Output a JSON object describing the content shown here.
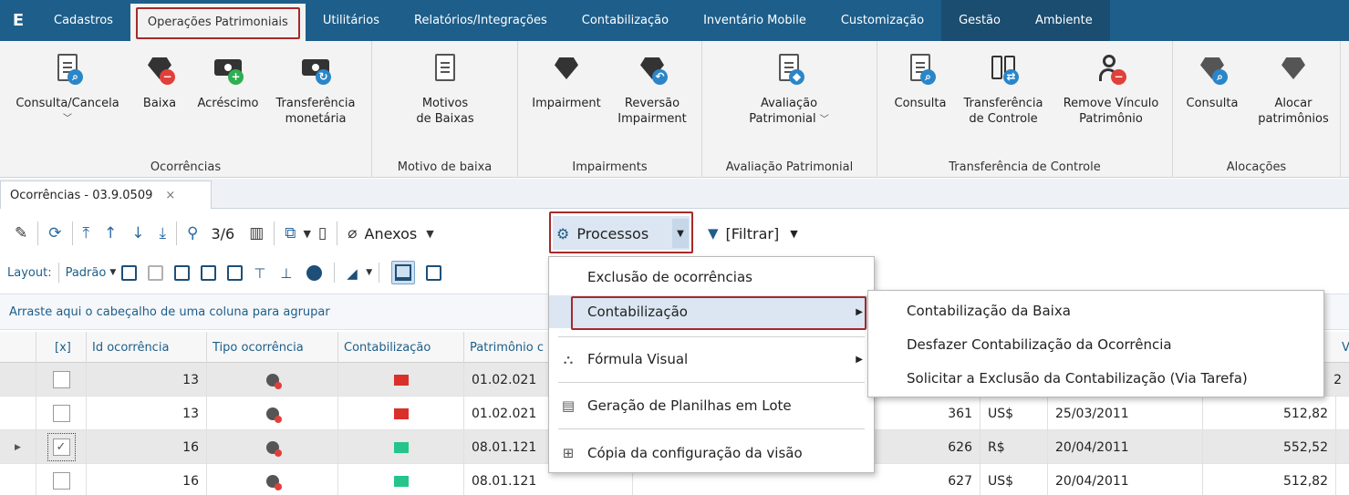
{
  "menubar": {
    "logo": "E",
    "items": [
      "Cadastros",
      "Operações Patrimoniais",
      "Utilitários",
      "Relatórios/Integrações",
      "Contabilização",
      "Inventário Mobile",
      "Customização",
      "Gestão",
      "Ambiente"
    ]
  },
  "ribbon": {
    "groups": [
      {
        "label": "Ocorrências",
        "buttons": [
          "Consulta/Cancela",
          "Baixa",
          "Acréscimo",
          "Transferência",
          "monetária"
        ]
      },
      {
        "label": "Motivo de baixa",
        "buttons": [
          "Motivos",
          "de Baixas"
        ]
      },
      {
        "label": "Impairments",
        "buttons": [
          "Impairment",
          "Reversão",
          "Impairment"
        ]
      },
      {
        "label": "Avaliação Patrimonial",
        "buttons": [
          "Avaliação",
          "Patrimonial"
        ]
      },
      {
        "label": "Transferência de Controle",
        "buttons": [
          "Consulta",
          "Transferência",
          "de Controle",
          "Remove Vínculo",
          "Patrimônio"
        ]
      },
      {
        "label": "Alocações",
        "buttons": [
          "Consulta",
          "Alocar",
          "patrimônios"
        ]
      }
    ]
  },
  "doctab": {
    "title": "Ocorrências - 03.9.0509",
    "close": "×"
  },
  "toolbar": {
    "counter": "3/6",
    "anexos": "Anexos",
    "processos": "Processos",
    "filtrar": "[Filtrar]"
  },
  "toolbar2": {
    "layout_label": "Layout:",
    "layout_value": "Padrão"
  },
  "grouphint": "Arraste aqui o cabeçalho de uma coluna para agrupar",
  "grid": {
    "columns": [
      "[x]",
      "Id ocorrência",
      "Tipo ocorrência",
      "Contabilização",
      "Patrimônio c",
      "V"
    ],
    "rows": [
      {
        "checked": false,
        "id": "13",
        "flag": "red",
        "patrimonio": "01.02.021",
        "num": "",
        "moeda": "",
        "data": "",
        "valor": "2"
      },
      {
        "checked": false,
        "id": "13",
        "flag": "red",
        "patrimonio": "01.02.021",
        "num": "361",
        "moeda": "US$",
        "data": "25/03/2011",
        "valor": "512,82"
      },
      {
        "checked": true,
        "id": "16",
        "flag": "green",
        "patrimonio": "08.01.121",
        "num": "626",
        "moeda": "R$",
        "data": "20/04/2011",
        "valor": "552,52"
      },
      {
        "checked": false,
        "id": "16",
        "flag": "green",
        "patrimonio": "08.01.121",
        "num": "627",
        "moeda": "US$",
        "data": "20/04/2011",
        "valor": "512,82"
      }
    ]
  },
  "menu": {
    "items": [
      "Exclusão de ocorrências",
      "Contabilização",
      "Fórmula Visual",
      "Geração de Planilhas em Lote",
      "Cópia da configuração da visão"
    ]
  },
  "submenu": {
    "items": [
      "Contabilização da Baixa",
      "Desfazer Contabilização da Ocorrência",
      "Solicitar a Exclusão da Contabilização (Via Tarefa)"
    ]
  },
  "colors": {
    "menubar": "#1d5e8a",
    "highlight": "#a52a2a",
    "flag_red": "#d9302b",
    "flag_green": "#25c48a"
  }
}
